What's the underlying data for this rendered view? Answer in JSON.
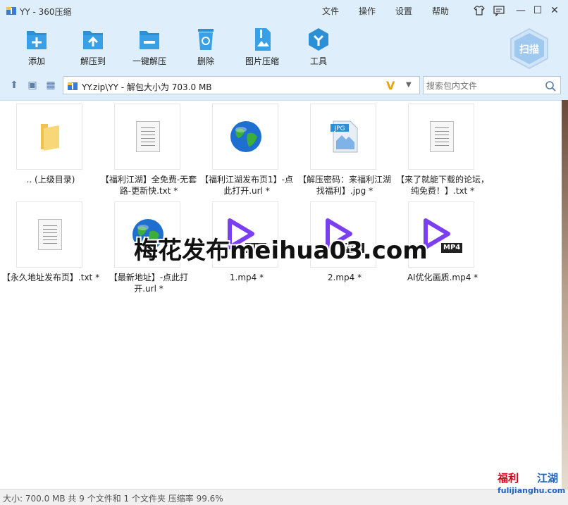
{
  "window": {
    "title": "YY - 360压缩"
  },
  "menu": {
    "file": "文件",
    "operation": "操作",
    "settings": "设置",
    "help": "帮助"
  },
  "toolbar": {
    "add": "添加",
    "extract_to": "解压到",
    "one_click_extract": "一键解压",
    "delete": "删除",
    "image_compress": "图片压缩",
    "tools": "工具",
    "scan": "扫描"
  },
  "address": {
    "path": "YY.zip\\YY - 解包大小为 703.0 MB",
    "search_placeholder": "搜索包内文件"
  },
  "files": [
    {
      "name": ".. (上级目录)",
      "type": "folder"
    },
    {
      "name": "【福利江湖】全免费-无套路-更新快.txt *",
      "type": "txt"
    },
    {
      "name": "【福利江湖发布页1】-点此打开.url *",
      "type": "url"
    },
    {
      "name": "【解压密码：来福利江湖找福利】.jpg *",
      "type": "jpg"
    },
    {
      "name": "【来了就能下载的论坛，纯免费！】.txt *",
      "type": "txt"
    },
    {
      "name": "【永久地址发布页】.txt *",
      "type": "txt"
    },
    {
      "name": "【最新地址】-点此打开.url *",
      "type": "url"
    },
    {
      "name": "1.mp4 *",
      "type": "mp4"
    },
    {
      "name": "2.mp4 *",
      "type": "mp4"
    },
    {
      "name": "AI优化画质.mp4 *",
      "type": "mp4"
    }
  ],
  "labels": {
    "jpg_badge": "JPG",
    "mp4_badge": "MP4"
  },
  "watermark": "梅花发布meihua03.com",
  "status": "大小: 700.0 MB 共 9 个文件和 1 个文件夹 压缩率 99.6%",
  "brand": {
    "part1": "福利",
    "part2": "江湖",
    "url": "fulijianghu.com"
  },
  "colors": {
    "chrome": "#dfeefb",
    "accent": "#2d8fd5",
    "brand_red": "#d0021b",
    "brand_blue": "#1e63c4"
  }
}
